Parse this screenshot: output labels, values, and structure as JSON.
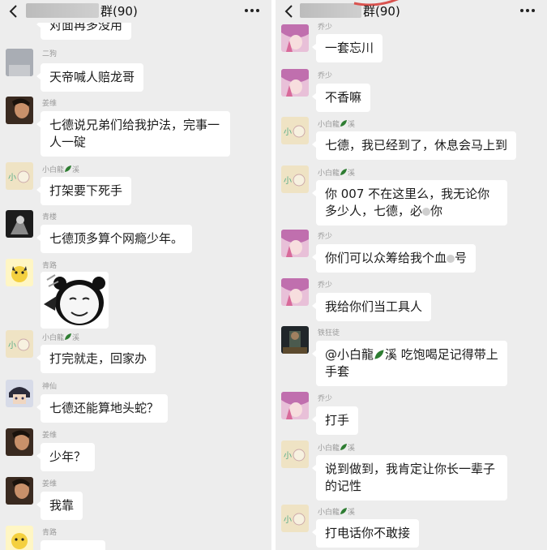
{
  "header": {
    "title_suffix": "群(90)"
  },
  "left": {
    "messages": [
      {
        "sender": "",
        "text": "对面再多没用"
      },
      {
        "sender": "二狗",
        "text": "天帝喊人赔龙哥"
      },
      {
        "sender": "姜维",
        "text": "七德说兄弟们给我护法，完事一人一碇"
      },
      {
        "sender_prefix": "小白龍",
        "sender_suffix": "溪",
        "text": "打架要下死手"
      },
      {
        "sender": "青楼",
        "text": "七德顶多算个网瘾少年。"
      },
      {
        "sender": "青路",
        "sticker": "panda-meme"
      },
      {
        "sender_prefix": "小白龍",
        "sender_suffix": "溪",
        "text": "打完就走，回家办"
      },
      {
        "sender": "神仙",
        "text": "七德还能算地头蛇？"
      },
      {
        "sender": "姜维",
        "text": "少年？"
      },
      {
        "sender": "姜维",
        "text": "我靠"
      },
      {
        "sender": "青路",
        "text": ""
      }
    ]
  },
  "right": {
    "messages": [
      {
        "sender": "乔少",
        "text": "一套忘川"
      },
      {
        "sender": "乔少",
        "text": "不香嘛"
      },
      {
        "sender_prefix": "小白龍",
        "sender_suffix": "溪",
        "text": "七德，我已经到了，休息会马上到"
      },
      {
        "sender_prefix": "小白龍",
        "sender_suffix": "溪",
        "text_a": "你 007 不在这里么，我无论你多少人，七德，必",
        "text_b": "你"
      },
      {
        "sender": "乔少",
        "text_a": "你们可以众筹给我个血",
        "text_b": "号"
      },
      {
        "sender": "乔少",
        "text": "我给你们当工具人"
      },
      {
        "sender": "铁狂徒",
        "text_a": "@小白龍",
        "text_b": "溪  吃饱喝足记得带上手套"
      },
      {
        "sender": "乔少",
        "text": "打手"
      },
      {
        "sender_prefix": "小白龍",
        "sender_suffix": "溪",
        "text": "说到做到，我肯定让你长一辈子的记性"
      },
      {
        "sender_prefix": "小白龍",
        "sender_suffix": "溪",
        "text": "打电话你不敢接"
      }
    ]
  },
  "colors": {
    "background": "#ededed",
    "bubble": "#ffffff",
    "sender_name": "#9a9a9a",
    "text": "#1a1a1a",
    "leaf_icon": "#2e7d32",
    "title_underline": "#d9534f"
  },
  "icons": {
    "back": "chevron-left-icon",
    "more": "more-dots-icon",
    "leaf": "leaf-emoji-icon"
  }
}
